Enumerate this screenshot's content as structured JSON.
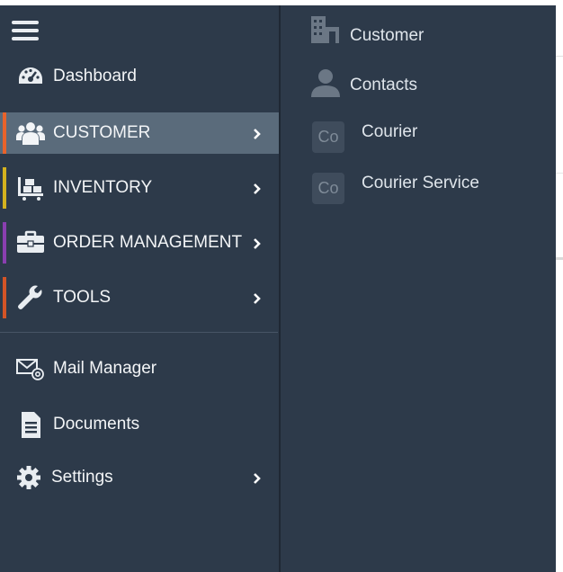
{
  "sidebar": {
    "items": [
      {
        "label": "Dashboard",
        "icon": "dashboard-gauge-icon"
      },
      {
        "label": "CUSTOMER",
        "icon": "users-group-icon",
        "accent": "#e8632b",
        "active": true
      },
      {
        "label": "INVENTORY",
        "icon": "cart-boxes-icon",
        "accent": "#d4b21f"
      },
      {
        "label": "ORDER MANAGEMENT",
        "icon": "briefcase-icon",
        "accent": "#8a3fb0"
      },
      {
        "label": "TOOLS",
        "icon": "wrench-icon",
        "accent": "#d45426"
      },
      {
        "label": "Mail Manager",
        "icon": "mail-at-icon"
      },
      {
        "label": "Documents",
        "icon": "document-icon"
      },
      {
        "label": "Settings",
        "icon": "gear-icon"
      }
    ]
  },
  "submenu": {
    "items": [
      {
        "label": "Customer",
        "icon": "building-icon"
      },
      {
        "label": "Contacts",
        "icon": "person-icon"
      },
      {
        "label": "Courier",
        "badge": "Co"
      },
      {
        "label": "Courier Service",
        "badge": "Co"
      }
    ]
  },
  "colors": {
    "panel_bg": "#2d3a4a",
    "active_bg": "#5a6b7b",
    "text": "#f3f5f7"
  }
}
